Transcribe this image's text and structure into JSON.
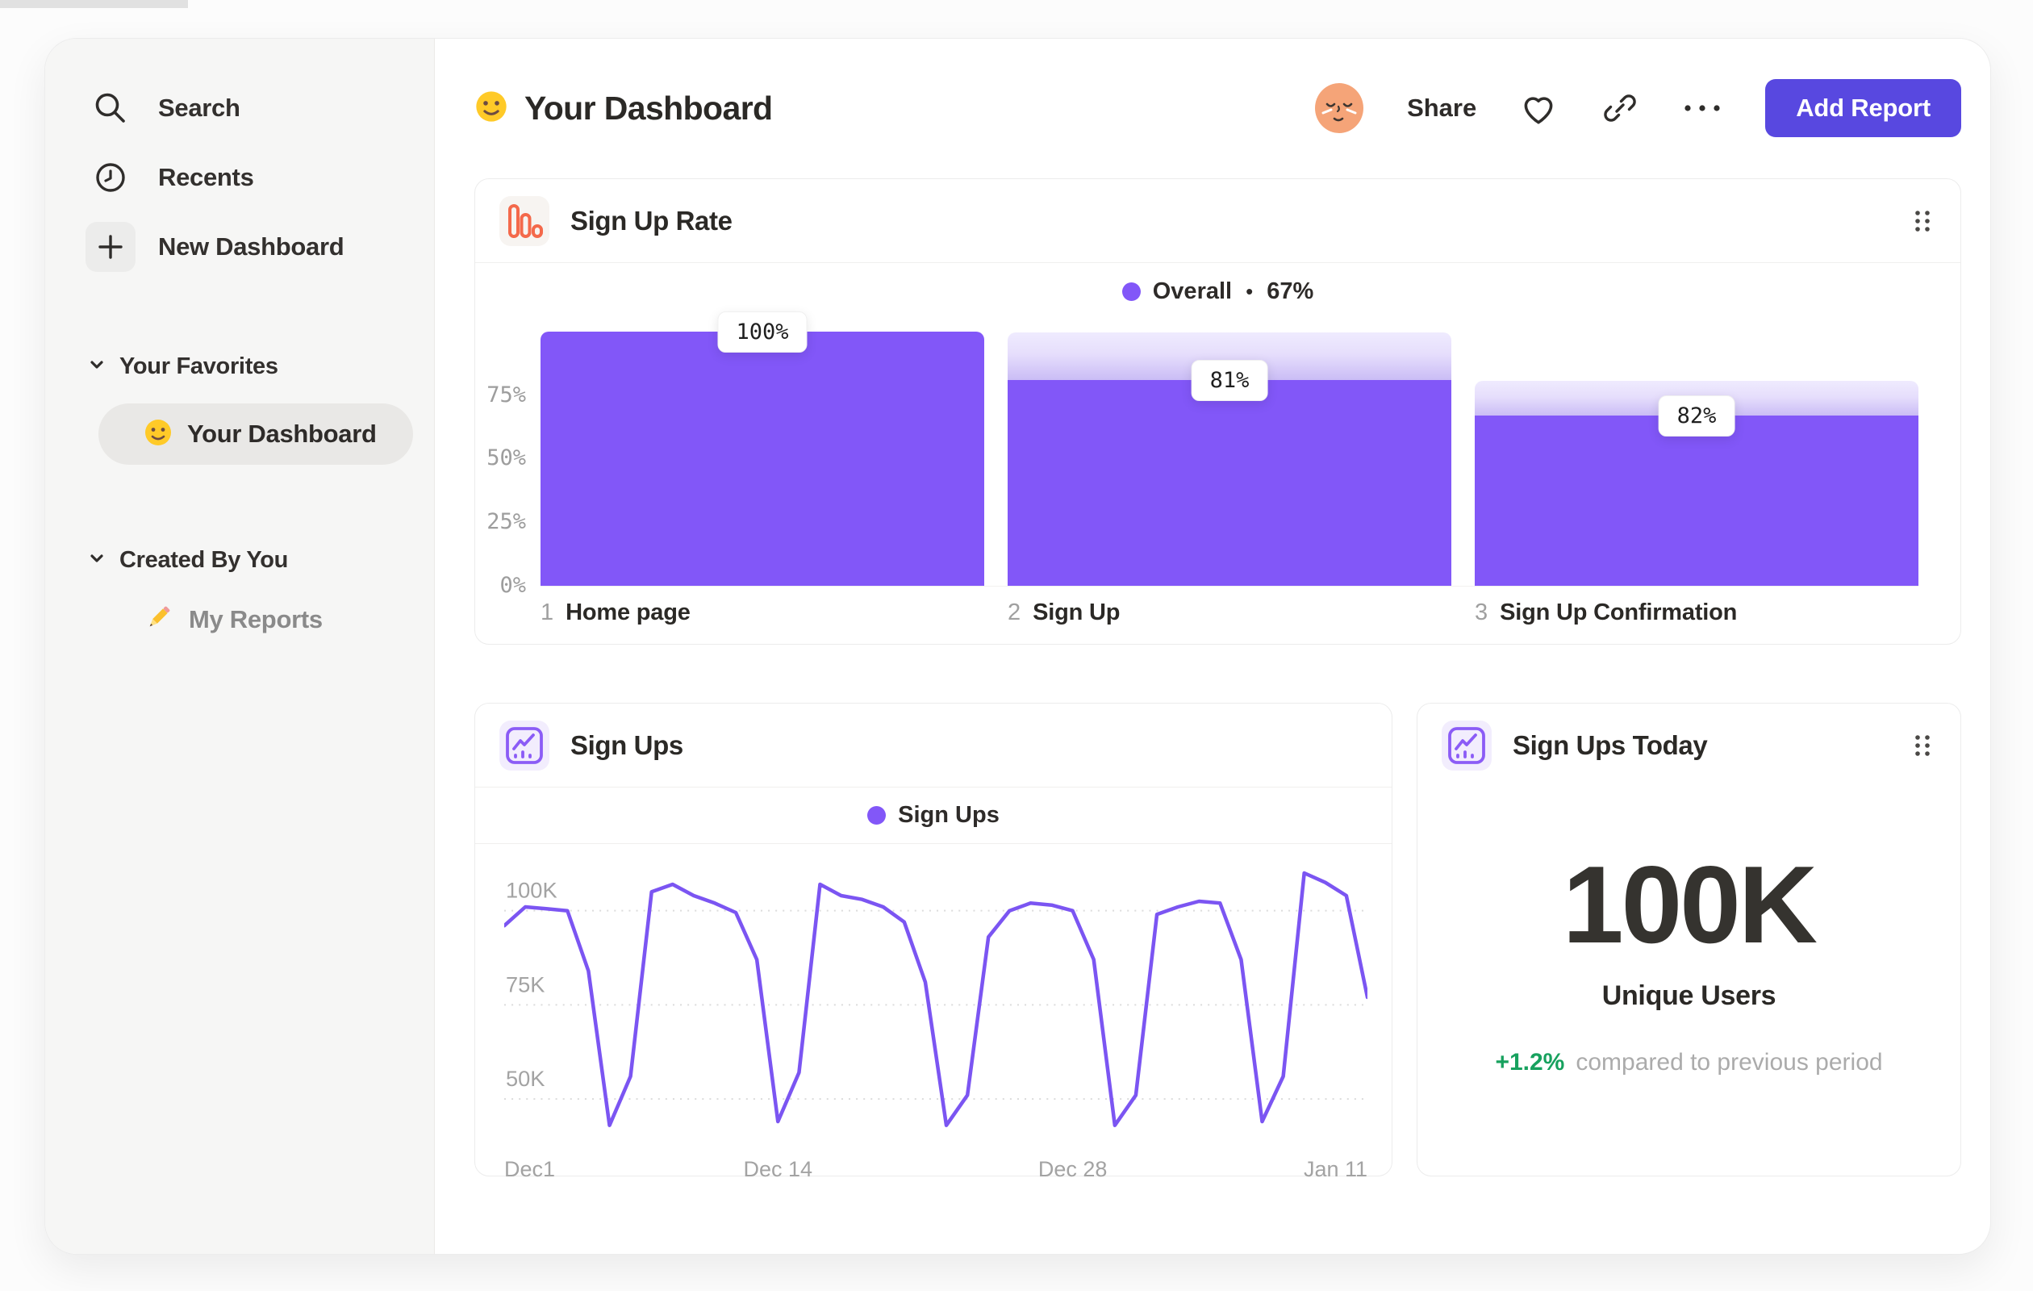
{
  "sidebar": {
    "items": [
      {
        "label": "Search",
        "icon": "search-icon"
      },
      {
        "label": "Recents",
        "icon": "clock-icon"
      },
      {
        "label": "New Dashboard",
        "icon": "plus-icon"
      }
    ],
    "sections": [
      {
        "label": "Your Favorites",
        "icon": "chevron-down-icon",
        "items": [
          {
            "label": "Your Dashboard",
            "icon": "smiley-emoji",
            "selected": true
          }
        ]
      },
      {
        "label": "Created By You",
        "icon": "chevron-down-icon",
        "items": [
          {
            "label": "My Reports",
            "icon": "pencil-emoji",
            "selected": false
          }
        ]
      }
    ]
  },
  "header": {
    "emoji": "smiley-emoji",
    "title": "Your Dashboard",
    "avatar": "orange-face-avatar",
    "share_label": "Share",
    "icons": [
      "heart-icon",
      "link-icon",
      "ellipsis-icon"
    ],
    "add_report_label": "Add Report"
  },
  "colors": {
    "accent_purple": "#8257f8",
    "line_purple": "#7b55f2",
    "button_indigo": "#5848e0",
    "funnel_icon_orange": "#f4694b",
    "delta_green": "#17a15e"
  },
  "chart_data": [
    {
      "type": "bar",
      "subtype": "funnel",
      "title": "Sign Up Rate",
      "legend": [
        {
          "label": "Overall",
          "separator": "•",
          "value": "67%"
        }
      ],
      "step_numbers": [
        "1",
        "2",
        "3"
      ],
      "categories": [
        "Home page",
        "Sign Up",
        "Sign Up Confirmation"
      ],
      "values": [
        100,
        81,
        67
      ],
      "displayed_labels": [
        "100%",
        "81%",
        "82%"
      ],
      "overall_conversion": "67%",
      "y_ticks": [
        {
          "label": "0%",
          "value": 0
        },
        {
          "label": "25%",
          "value": 25
        },
        {
          "label": "50%",
          "value": 50
        },
        {
          "label": "75%",
          "value": 75
        }
      ],
      "ylim": [
        0,
        105
      ],
      "grid": false,
      "legend_position": "top-center",
      "bar_color": "#8257f8"
    },
    {
      "type": "line",
      "title": "Sign Ups",
      "legend": [
        {
          "label": "Sign Ups"
        }
      ],
      "unit": "K",
      "x_tick_labels": [
        "Dec1",
        "Dec 14",
        "Dec 28",
        "Jan 11"
      ],
      "x_tick_indices": [
        0,
        13,
        27,
        41
      ],
      "y_ticks": [
        {
          "label": "100K",
          "value": 100
        },
        {
          "label": "75K",
          "value": 75
        },
        {
          "label": "50K",
          "value": 50
        }
      ],
      "ylim": [
        38,
        113
      ],
      "grid": "dotted-horizontal",
      "legend_position": "top-center",
      "line_color": "#7b55f2",
      "values": [
        96,
        101,
        100.5,
        100,
        84,
        43,
        56,
        105,
        107,
        104,
        102,
        99.5,
        87,
        44,
        57,
        107,
        104,
        103,
        101,
        97,
        81,
        43,
        51,
        93,
        100,
        102,
        101.5,
        100,
        87,
        43,
        51,
        99,
        101,
        102.5,
        102,
        87,
        44,
        56,
        110,
        107.5,
        104,
        77
      ]
    },
    {
      "type": "metric",
      "title": "Sign Ups Today",
      "value": "100K",
      "label": "Unique Users",
      "delta": "+1.2%",
      "comparison": "compared to previous period"
    }
  ]
}
